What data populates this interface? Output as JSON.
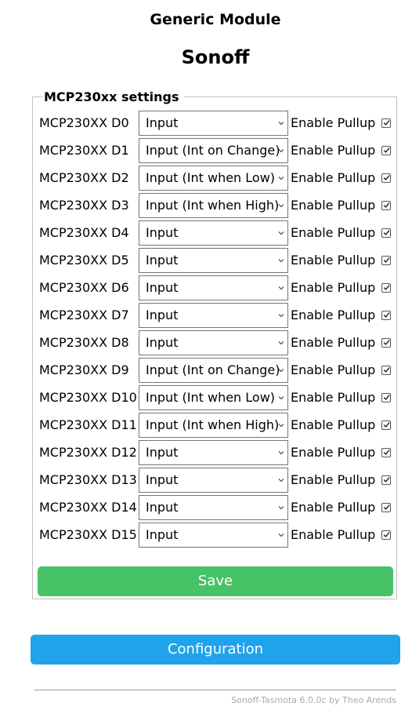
{
  "header": {
    "module_type": "Generic Module",
    "device_name": "Sonoff"
  },
  "settings": {
    "legend": "MCP230xx settings",
    "pullup_label": "Enable Pullup",
    "pins": [
      {
        "label": "MCP230XX D0",
        "mode": "Input",
        "pullup": true
      },
      {
        "label": "MCP230XX D1",
        "mode": "Input (Int on Change)",
        "pullup": true
      },
      {
        "label": "MCP230XX D2",
        "mode": "Input (Int when Low)",
        "pullup": true
      },
      {
        "label": "MCP230XX D3",
        "mode": "Input (Int when High)",
        "pullup": true
      },
      {
        "label": "MCP230XX D4",
        "mode": "Input",
        "pullup": true
      },
      {
        "label": "MCP230XX D5",
        "mode": "Input",
        "pullup": true
      },
      {
        "label": "MCP230XX D6",
        "mode": "Input",
        "pullup": true
      },
      {
        "label": "MCP230XX D7",
        "mode": "Input",
        "pullup": true
      },
      {
        "label": "MCP230XX D8",
        "mode": "Input",
        "pullup": true
      },
      {
        "label": "MCP230XX D9",
        "mode": "Input (Int on Change)",
        "pullup": true
      },
      {
        "label": "MCP230XX D10",
        "mode": "Input (Int when Low)",
        "pullup": true
      },
      {
        "label": "MCP230XX D11",
        "mode": "Input (Int when High)",
        "pullup": true
      },
      {
        "label": "MCP230XX D12",
        "mode": "Input",
        "pullup": true
      },
      {
        "label": "MCP230XX D13",
        "mode": "Input",
        "pullup": true
      },
      {
        "label": "MCP230XX D14",
        "mode": "Input",
        "pullup": true
      },
      {
        "label": "MCP230XX D15",
        "mode": "Input",
        "pullup": true
      }
    ],
    "save_label": "Save"
  },
  "navigation": {
    "configuration_label": "Configuration"
  },
  "footer": {
    "text": "Sonoff-Tasmota 6.0.0c by Theo Arends"
  },
  "colors": {
    "save_button": "#47c266",
    "config_button": "#1fa3ec"
  },
  "icons": {
    "select": "chevron-down-icon",
    "checkbox": "check-icon"
  }
}
